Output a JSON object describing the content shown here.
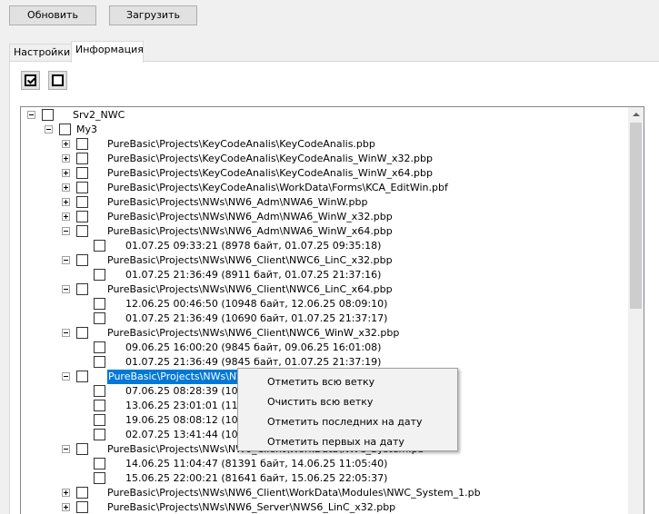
{
  "toolbar": {
    "refresh_label": "Обновить",
    "load_label": "Загрузить"
  },
  "tabs": [
    {
      "label": "Настройки",
      "active": false
    },
    {
      "label": "Информация",
      "active": true
    }
  ],
  "check_buttons": [
    {
      "icon": "checked-checkbox-icon"
    },
    {
      "icon": "unchecked-checkbox-icon"
    }
  ],
  "tree": {
    "rows": [
      {
        "text": "Srv2_NWC"
      },
      {
        "text": "My3"
      },
      {
        "text": "PureBasic\\Projects\\KeyCodeAnalis\\KeyCodeAnalis.pbp"
      },
      {
        "text": "PureBasic\\Projects\\KeyCodeAnalis\\KeyCodeAnalis_WinW_x32.pbp"
      },
      {
        "text": "PureBasic\\Projects\\KeyCodeAnalis\\KeyCodeAnalis_WinW_x64.pbp"
      },
      {
        "text": "PureBasic\\Projects\\KeyCodeAnalis\\WorkData\\Forms\\KCA_EditWin.pbf"
      },
      {
        "text": "PureBasic\\Projects\\NWs\\NW6_Adm\\NWA6_WinW.pbp"
      },
      {
        "text": "PureBasic\\Projects\\NWs\\NW6_Adm\\NWA6_WinW_x32.pbp"
      },
      {
        "text": "PureBasic\\Projects\\NWs\\NW6_Adm\\NWA6_WinW_x64.pbp"
      },
      {
        "text": "01.07.25 09:33:21 (8978 байт, 01.07.25 09:35:18)"
      },
      {
        "text": "PureBasic\\Projects\\NWs\\NW6_Client\\NWC6_LinC_x32.pbp"
      },
      {
        "text": "01.07.25 21:36:49 (8911 байт, 01.07.25 21:37:16)"
      },
      {
        "text": "PureBasic\\Projects\\NWs\\NW6_Client\\NWC6_LinC_x64.pbp"
      },
      {
        "text": "12.06.25 00:46:50 (10948 байт, 12.06.25 08:09:10)"
      },
      {
        "text": "01.07.25 21:36:49 (10690 байт, 01.07.25 21:37:17)"
      },
      {
        "text": "PureBasic\\Projects\\NWs\\NW6_Client\\NWC6_WinW_x32.pbp"
      },
      {
        "text": "09.06.25 16:00:20 (9845 байт, 09.06.25 16:01:08)"
      },
      {
        "text": "01.07.25 21:36:49 (9845 байт, 01.07.25 21:37:19)"
      },
      {
        "text": "PureBasic\\Projects\\NWs\\NW6_Client\\NWC6_WinW_x64.pbp"
      },
      {
        "text": "07.06.25 08:28:39 (10664 байт, 07.06.25 08:29:20)"
      },
      {
        "text": "13.06.25 23:01:01 (11318 байт, 13.06.25 23:01:40)"
      },
      {
        "text": "19.06.25 08:08:12 (10664 байт, 19.06.25 08:08:50)"
      },
      {
        "text": "02.07.25 13:41:44 (10664 байт, 02.07.25 13:42:20)"
      },
      {
        "text": "PureBasic\\Projects\\NWs\\NW6_Client\\WorkData\\NWC_System.pb"
      },
      {
        "text": "14.06.25 11:04:47 (81391 байт, 14.06.25 11:05:40)"
      },
      {
        "text": "15.06.25 22:00:21 (81641 байт, 15.06.25 22:05:37)"
      },
      {
        "text": "PureBasic\\Projects\\NWs\\NW6_Client\\WorkData\\Modules\\NWC_System_1.pb"
      },
      {
        "text": "PureBasic\\Projects\\NWs\\NW6_Server\\NWS6_LinC_x32.pbp"
      }
    ]
  },
  "context_menu": {
    "items": [
      "Отметить всю ветку",
      "Очистить всю ветку",
      "Отметить последних на дату",
      "Отметить первых на дату"
    ]
  },
  "colors": {
    "selection": "#0078d7",
    "window_bg": "#f0f0f0"
  }
}
